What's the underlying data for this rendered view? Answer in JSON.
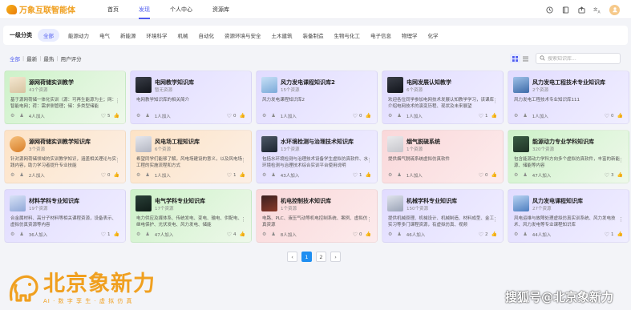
{
  "app": {
    "logo_text": "万象互联智能体"
  },
  "nav": {
    "items": [
      "首页",
      "发现",
      "个人中心",
      "资源库"
    ],
    "active": 1
  },
  "categories": {
    "heading": "一级分类",
    "items": [
      "全部",
      "能源动力",
      "电气",
      "新能源",
      "环境科学",
      "机械",
      "自动化",
      "资源环境与安全",
      "土木建筑",
      "装备制造",
      "生物与化工",
      "电子信息",
      "物理学",
      "化学"
    ],
    "active": 0
  },
  "filters": {
    "items": [
      "全部",
      "最新",
      "最热",
      "用户评分"
    ],
    "active": 0,
    "separator": "|"
  },
  "search": {
    "placeholder": "搜索知识库..."
  },
  "cards": [
    {
      "title": "源网荷储实训教学",
      "count": "41个资源",
      "desc": "基于源网荷储一体化实训（源：可再生能源为主；网：智能电网；荷：需求侧管理；储：多类型储能",
      "joined": "4人加入",
      "likes": "5",
      "color": "green"
    },
    {
      "title": "电网教学知识库",
      "count": "暂无资源",
      "desc": "电网教学知识库的相关简介",
      "joined": "1人加入",
      "likes": "0",
      "color": "purple"
    },
    {
      "title": "风力发电课程知识库2",
      "count": "15个资源",
      "desc": "风力发电课程知识库2",
      "joined": "1人加入",
      "likes": "0",
      "color": "purple"
    },
    {
      "title": "电网发展认知教学",
      "count": "6个资源",
      "desc": "欢迎各位同学参加电网技术发展认知教学学习，该课库介绍电网技术的演变历程、现状及未来展望",
      "joined": "1人加入",
      "likes": "1",
      "color": "purple"
    },
    {
      "title": "风力发电工程技术专业知识库",
      "count": "2个资源",
      "desc": "风力发电工程技术专业知识库111",
      "joined": "1人加入",
      "likes": "0",
      "color": "purple"
    },
    {
      "title": "源网荷储实训教学知识库",
      "count": "3个资源",
      "desc": "针对源网荷储领域的实训教学知识，涵盖相关理论与实践内容，助力学习者提升专业技能",
      "joined": "2人加入",
      "likes": "0",
      "color": "orange"
    },
    {
      "title": "风电场工程知识库",
      "count": "6个资源",
      "desc": "希望同学们能够了解，风电场建设的意义，以及风电场工程的实施流程和方式",
      "joined": "1人加入",
      "likes": "1",
      "color": "orange"
    },
    {
      "title": "水环境检测与治理技术知识库",
      "count": "13个资源",
      "desc": "包括水环境检测与治理技术设备学生虚拟仿真软件、水环境检测与治理技术综合实训平台使用说明",
      "joined": "43人加入",
      "likes": "1",
      "color": "purple"
    },
    {
      "title": "烟气脱硫系统",
      "count": "1个资源",
      "desc": "提供烟气脱硫系统虚拟仿真软件",
      "joined": "1人加入",
      "likes": "0",
      "color": "pink"
    },
    {
      "title": "能源动力专业学科知识库",
      "count": "320个资源",
      "desc": "包含能源动力学科方向多个虚拟仿真软件，丰富的新能源、储能等内容",
      "joined": "47人加入",
      "likes": "3",
      "color": "green"
    },
    {
      "title": "材料学科专业知识库",
      "count": "19个资源",
      "desc": "合金属材料、高分子材料等相关课程资源，设备表示、虚拟仿真资源等内容",
      "joined": "36人加入",
      "likes": "1",
      "color": "purple"
    },
    {
      "title": "电气学科专业知识库",
      "count": "17个资源",
      "desc": "电力供应及媒体系、传统发电、变电、输电、供配电、继电保护、光伏发电、风力发电、储能",
      "joined": "47人加入",
      "likes": "4",
      "color": "green"
    },
    {
      "title": "机电控制技术知识库",
      "count": "1个资源",
      "desc": "电路、PLC、液压气动等机电控制系统、案例、虚拟仿真资源",
      "joined": "8人加入",
      "likes": "0",
      "color": "pink"
    },
    {
      "title": "机械学科专业知识库",
      "count": "150个资源",
      "desc": "提供机械原理、机械设计、机械制造、材料成型、金工实习等多门课程资源，有虚拟仿真、视频",
      "joined": "46人加入",
      "likes": "2",
      "color": "purple"
    },
    {
      "title": "风力发电课程知识库",
      "count": "27个资源",
      "desc": "风电运维与故障处理虚拟仿真实训系统、风力发电技术、风力发电等专业课程知识库",
      "joined": "44人加入",
      "likes": "1",
      "color": "purple"
    }
  ],
  "pagination": {
    "prev": "‹",
    "pages": [
      "1",
      "2"
    ],
    "active": 0,
    "next": "›"
  },
  "watermark": {
    "title": "北京象新力",
    "subtitle": "AI · 数 字 孪 生 · 虚 拟 仿 真",
    "sohu": "搜狐号@北京象新力"
  },
  "colors": {
    "accent": "#4f5cf0",
    "brand": "#f0a020",
    "page_active": "#1f8ef1"
  }
}
